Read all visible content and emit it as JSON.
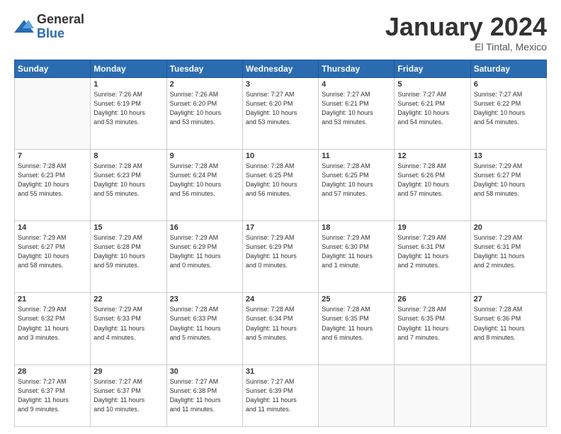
{
  "logo": {
    "general": "General",
    "blue": "Blue"
  },
  "header": {
    "month": "January 2024",
    "location": "El Tintal, Mexico"
  },
  "weekdays": [
    "Sunday",
    "Monday",
    "Tuesday",
    "Wednesday",
    "Thursday",
    "Friday",
    "Saturday"
  ],
  "weeks": [
    [
      {
        "day": "",
        "info": ""
      },
      {
        "day": "1",
        "info": "Sunrise: 7:26 AM\nSunset: 6:19 PM\nDaylight: 10 hours\nand 53 minutes."
      },
      {
        "day": "2",
        "info": "Sunrise: 7:26 AM\nSunset: 6:20 PM\nDaylight: 10 hours\nand 53 minutes."
      },
      {
        "day": "3",
        "info": "Sunrise: 7:27 AM\nSunset: 6:20 PM\nDaylight: 10 hours\nand 53 minutes."
      },
      {
        "day": "4",
        "info": "Sunrise: 7:27 AM\nSunset: 6:21 PM\nDaylight: 10 hours\nand 53 minutes."
      },
      {
        "day": "5",
        "info": "Sunrise: 7:27 AM\nSunset: 6:21 PM\nDaylight: 10 hours\nand 54 minutes."
      },
      {
        "day": "6",
        "info": "Sunrise: 7:27 AM\nSunset: 6:22 PM\nDaylight: 10 hours\nand 54 minutes."
      }
    ],
    [
      {
        "day": "7",
        "info": "Sunrise: 7:28 AM\nSunset: 6:23 PM\nDaylight: 10 hours\nand 55 minutes."
      },
      {
        "day": "8",
        "info": "Sunrise: 7:28 AM\nSunset: 6:23 PM\nDaylight: 10 hours\nand 55 minutes."
      },
      {
        "day": "9",
        "info": "Sunrise: 7:28 AM\nSunset: 6:24 PM\nDaylight: 10 hours\nand 56 minutes."
      },
      {
        "day": "10",
        "info": "Sunrise: 7:28 AM\nSunset: 6:25 PM\nDaylight: 10 hours\nand 56 minutes."
      },
      {
        "day": "11",
        "info": "Sunrise: 7:28 AM\nSunset: 6:25 PM\nDaylight: 10 hours\nand 57 minutes."
      },
      {
        "day": "12",
        "info": "Sunrise: 7:28 AM\nSunset: 6:26 PM\nDaylight: 10 hours\nand 57 minutes."
      },
      {
        "day": "13",
        "info": "Sunrise: 7:29 AM\nSunset: 6:27 PM\nDaylight: 10 hours\nand 58 minutes."
      }
    ],
    [
      {
        "day": "14",
        "info": "Sunrise: 7:29 AM\nSunset: 6:27 PM\nDaylight: 10 hours\nand 58 minutes."
      },
      {
        "day": "15",
        "info": "Sunrise: 7:29 AM\nSunset: 6:28 PM\nDaylight: 10 hours\nand 59 minutes."
      },
      {
        "day": "16",
        "info": "Sunrise: 7:29 AM\nSunset: 6:29 PM\nDaylight: 11 hours\nand 0 minutes."
      },
      {
        "day": "17",
        "info": "Sunrise: 7:29 AM\nSunset: 6:29 PM\nDaylight: 11 hours\nand 0 minutes."
      },
      {
        "day": "18",
        "info": "Sunrise: 7:29 AM\nSunset: 6:30 PM\nDaylight: 11 hours\nand 1 minute."
      },
      {
        "day": "19",
        "info": "Sunrise: 7:29 AM\nSunset: 6:31 PM\nDaylight: 11 hours\nand 2 minutes."
      },
      {
        "day": "20",
        "info": "Sunrise: 7:29 AM\nSunset: 6:31 PM\nDaylight: 11 hours\nand 2 minutes."
      }
    ],
    [
      {
        "day": "21",
        "info": "Sunrise: 7:29 AM\nSunset: 6:32 PM\nDaylight: 11 hours\nand 3 minutes."
      },
      {
        "day": "22",
        "info": "Sunrise: 7:29 AM\nSunset: 6:33 PM\nDaylight: 11 hours\nand 4 minutes."
      },
      {
        "day": "23",
        "info": "Sunrise: 7:28 AM\nSunset: 6:33 PM\nDaylight: 11 hours\nand 5 minutes."
      },
      {
        "day": "24",
        "info": "Sunrise: 7:28 AM\nSunset: 6:34 PM\nDaylight: 11 hours\nand 5 minutes."
      },
      {
        "day": "25",
        "info": "Sunrise: 7:28 AM\nSunset: 6:35 PM\nDaylight: 11 hours\nand 6 minutes."
      },
      {
        "day": "26",
        "info": "Sunrise: 7:28 AM\nSunset: 6:35 PM\nDaylight: 11 hours\nand 7 minutes."
      },
      {
        "day": "27",
        "info": "Sunrise: 7:28 AM\nSunset: 6:36 PM\nDaylight: 11 hours\nand 8 minutes."
      }
    ],
    [
      {
        "day": "28",
        "info": "Sunrise: 7:27 AM\nSunset: 6:37 PM\nDaylight: 11 hours\nand 9 minutes."
      },
      {
        "day": "29",
        "info": "Sunrise: 7:27 AM\nSunset: 6:37 PM\nDaylight: 11 hours\nand 10 minutes."
      },
      {
        "day": "30",
        "info": "Sunrise: 7:27 AM\nSunset: 6:38 PM\nDaylight: 11 hours\nand 11 minutes."
      },
      {
        "day": "31",
        "info": "Sunrise: 7:27 AM\nSunset: 6:39 PM\nDaylight: 11 hours\nand 11 minutes."
      },
      {
        "day": "",
        "info": ""
      },
      {
        "day": "",
        "info": ""
      },
      {
        "day": "",
        "info": ""
      }
    ]
  ]
}
